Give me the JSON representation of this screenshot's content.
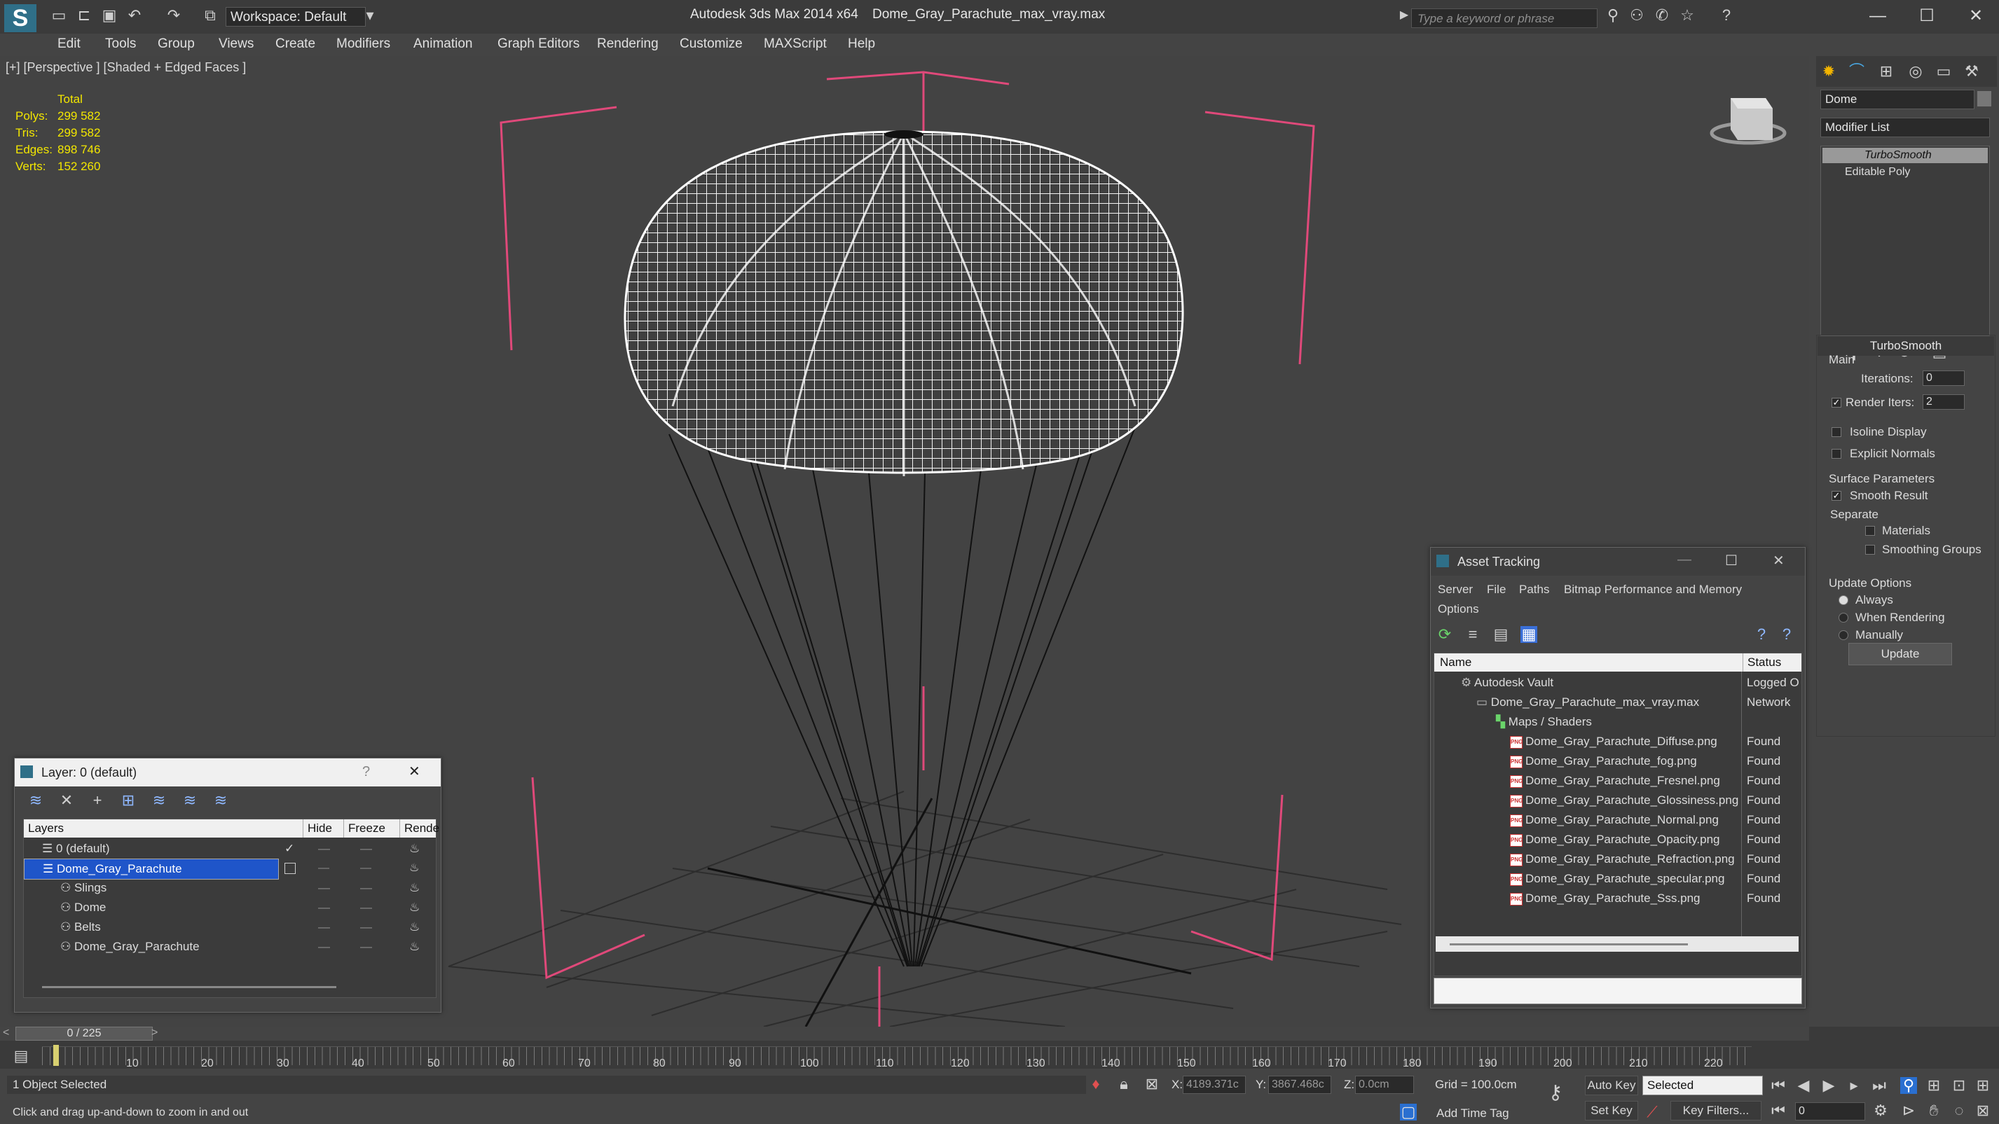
{
  "titlebar": {
    "workspace": "Workspace: Default",
    "app_name": "Autodesk 3ds Max  2014 x64",
    "file_name": "Dome_Gray_Parachute_max_vray.max",
    "search_placeholder": "Type a keyword or phrase"
  },
  "menu": [
    "Edit",
    "Tools",
    "Group",
    "Views",
    "Create",
    "Modifiers",
    "Animation",
    "Graph Editors",
    "Rendering",
    "Customize",
    "MAXScript",
    "Help"
  ],
  "viewport": {
    "label": "[+] [Perspective ] [Shaded + Edged Faces ]",
    "stats": {
      "header": "Total",
      "rows": [
        {
          "label": "Polys:",
          "value": "299 582"
        },
        {
          "label": "Tris:",
          "value": "299 582"
        },
        {
          "label": "Edges:",
          "value": "898 746"
        },
        {
          "label": "Verts:",
          "value": "152 260"
        }
      ]
    }
  },
  "command_panel": {
    "object_name": "Dome",
    "modifier_list": "Modifier List",
    "stack": [
      "TurboSmooth",
      "Editable Poly"
    ],
    "rollout_title": "TurboSmooth",
    "main_label": "Main",
    "iterations_label": "Iterations:",
    "iterations_value": "0",
    "render_iters_label": "Render Iters:",
    "render_iters_value": "2",
    "isoline_label": "Isoline Display",
    "explicit_normals_label": "Explicit Normals",
    "surface_params_label": "Surface Parameters",
    "smooth_result_label": "Smooth Result",
    "separate_label": "Separate",
    "materials_label": "Materials",
    "smoothing_groups_label": "Smoothing Groups",
    "update_options_label": "Update Options",
    "always_label": "Always",
    "when_rendering_label": "When Rendering",
    "manually_label": "Manually",
    "update_button": "Update"
  },
  "asset_tracking": {
    "title": "Asset Tracking",
    "menu": [
      "Server",
      "File",
      "Paths",
      "Bitmap Performance and Memory"
    ],
    "menu2": "Options",
    "col_name": "Name",
    "col_status": "Status",
    "rows": [
      {
        "name": "Autodesk Vault",
        "status": "Logged O"
      },
      {
        "name": "Dome_Gray_Parachute_max_vray.max",
        "status": "Network"
      },
      {
        "name": "Maps / Shaders",
        "status": ""
      },
      {
        "name": "Dome_Gray_Parachute_Diffuse.png",
        "status": "Found"
      },
      {
        "name": "Dome_Gray_Parachute_fog.png",
        "status": "Found"
      },
      {
        "name": "Dome_Gray_Parachute_Fresnel.png",
        "status": "Found"
      },
      {
        "name": "Dome_Gray_Parachute_Glossiness.png",
        "status": "Found"
      },
      {
        "name": "Dome_Gray_Parachute_Normal.png",
        "status": "Found"
      },
      {
        "name": "Dome_Gray_Parachute_Opacity.png",
        "status": "Found"
      },
      {
        "name": "Dome_Gray_Parachute_Refraction.png",
        "status": "Found"
      },
      {
        "name": "Dome_Gray_Parachute_specular.png",
        "status": "Found"
      },
      {
        "name": "Dome_Gray_Parachute_Sss.png",
        "status": "Found"
      }
    ]
  },
  "layer_window": {
    "title": "Layer: 0 (default)",
    "help": "?",
    "col_layers": "Layers",
    "col_hide": "Hide",
    "col_freeze": "Freeze",
    "col_render": "Rende",
    "rows": [
      "0 (default)",
      "Dome_Gray_Parachute",
      "Slings",
      "Dome",
      "Belts",
      "Dome_Gray_Parachute"
    ]
  },
  "timeline": {
    "frame": "0 / 225",
    "ticks": [
      "10",
      "20",
      "30",
      "40",
      "50",
      "60",
      "70",
      "80",
      "90",
      "100",
      "110",
      "120",
      "130",
      "140",
      "150",
      "160",
      "170",
      "180",
      "190",
      "200",
      "210",
      "220"
    ]
  },
  "status": {
    "selection": "1 Object Selected",
    "hint": "Click and drag up-and-down to zoom in and out",
    "x_label": "X:",
    "x_value": "4189.371c",
    "y_label": "Y:",
    "y_value": "3867.468c",
    "z_label": "Z:",
    "z_value": "0.0cm",
    "grid": "Grid = 100.0cm",
    "auto_key": "Auto Key",
    "selected": "Selected",
    "set_key": "Set Key",
    "key_filters": "Key Filters...",
    "add_time_tag": "Add Time Tag",
    "frame_value": "0"
  },
  "colors": {
    "accent": "#2f6f88",
    "stats": "#f2e600",
    "gizmo": "#e0497a",
    "selection": "#1f55c9"
  }
}
